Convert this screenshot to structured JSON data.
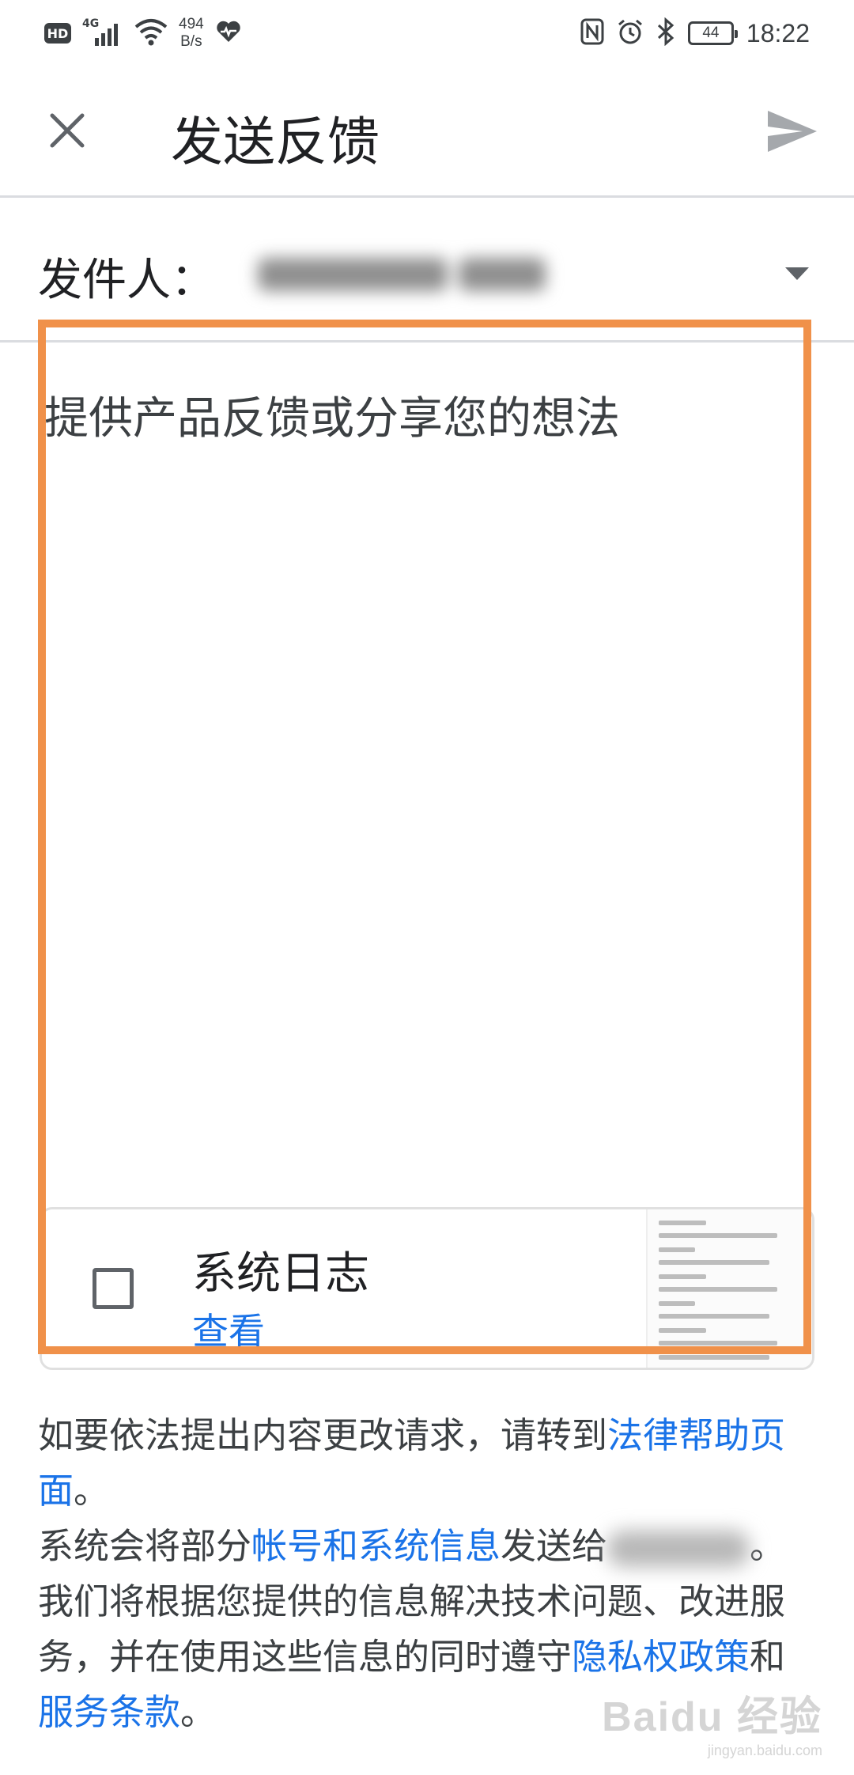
{
  "status_bar": {
    "hd_badge": "HD",
    "network_type": "4G",
    "speed_value": "494",
    "speed_unit": "B/s",
    "battery": "44",
    "time": "18:22",
    "icons": [
      "hd-icon",
      "signal-icon",
      "wifi-icon",
      "heart-icon",
      "nfc-icon",
      "alarm-icon",
      "bluetooth-icon",
      "battery-icon"
    ]
  },
  "header": {
    "title": "发送反馈",
    "close_icon": "close-icon",
    "send_icon": "send-icon"
  },
  "from_row": {
    "label": "发件人："
  },
  "feedback": {
    "placeholder": "提供产品反馈或分享您的想法"
  },
  "system_log": {
    "title": "系统日志",
    "view_link": "查看",
    "checked": false
  },
  "footer": {
    "line1_prefix": "如要依法提出内容更改请求，请转到",
    "legal_link": "法律帮助页面",
    "line1_suffix": "。",
    "line2_prefix": "系统会将部分",
    "account_link": "帐号和系统信息",
    "line2_middle": "发送给",
    "line2_suffix": "。我们将根据您提供的信息解决技术问题、改进服务，并在使用这些信息的同时遵守",
    "privacy_link": "隐私权政策",
    "and": "和",
    "terms_link": "服务条款",
    "end": "。"
  },
  "watermark": {
    "logo": "Baidu 经验",
    "url": "jingyan.baidu.com"
  },
  "colors": {
    "accent": "#1a73e8",
    "highlight": "#f0914a",
    "divider": "#dadce0",
    "text": "#202124"
  }
}
